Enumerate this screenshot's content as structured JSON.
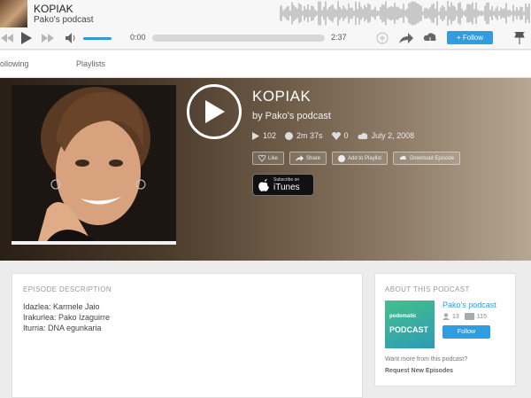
{
  "player": {
    "title": "KOPIAK",
    "subtitle": "Pako's podcast",
    "current_time": "0:00",
    "duration": "2:37",
    "follow_label": "+ Follow",
    "progress": 0
  },
  "subnav": {
    "tabs": [
      {
        "label": "ollowing"
      },
      {
        "label": "Playlists"
      }
    ]
  },
  "episode": {
    "title": "KOPIAK",
    "by": "by Pako's podcast",
    "plays": "102",
    "length": "2m 37s",
    "likes": "0",
    "date": "July 2, 2008",
    "actions": {
      "like": "Like",
      "share": "Share",
      "add_playlist": "Add to Playlist",
      "download": "Download Episode"
    },
    "itunes_small": "Subscribe on",
    "itunes_big": "iTunes"
  },
  "description": {
    "label": "EPISODE DESCRIPTION",
    "lines": [
      "Idazlea: Karmele Jaio",
      "Irakurlea: Pako Izaguirre",
      "Iturria: DNA egunkaria"
    ]
  },
  "about": {
    "label": "ABOUT THIS PODCAST",
    "podcast_name": "Pako's podcast",
    "followers": "13",
    "episodes": "115",
    "follow_label": "Follow",
    "cover_brand": "podomatic",
    "cover_word": "PODCAST",
    "want_more": "Want more from this podcast?",
    "request": "Request New Episodes"
  },
  "colors": {
    "accent": "#2f9de0",
    "hero_dark": "#2a1f16",
    "hero_light": "#b5a792"
  },
  "icons": [
    "rewind-icon",
    "play-icon",
    "forward-icon",
    "volume-icon",
    "lock-icon",
    "share-icon",
    "download-cloud-icon",
    "pin-icon",
    "heart-icon",
    "headphones-icon",
    "apple-icon"
  ]
}
